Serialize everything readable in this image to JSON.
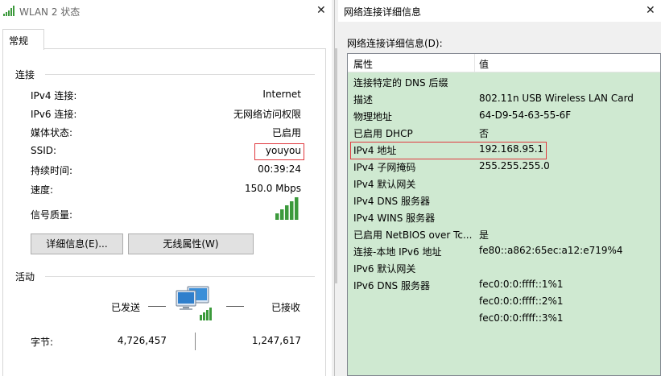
{
  "left_window": {
    "title": "WLAN 2 状态",
    "close_glyph": "✕",
    "tab": "常规",
    "connection": {
      "heading": "连接",
      "rows": [
        {
          "label": "IPv4 连接:",
          "value": "Internet"
        },
        {
          "label": "IPv6 连接:",
          "value": "无网络访问权限"
        },
        {
          "label": "媒体状态:",
          "value": "已启用"
        },
        {
          "label": "SSID:",
          "value": "youyou"
        },
        {
          "label": "持续时间:",
          "value": "00:39:24"
        },
        {
          "label": "速度:",
          "value": "150.0 Mbps"
        }
      ],
      "signal_label": "信号质量:",
      "signal_bars_lit": 5,
      "signal_bars_total": 5
    },
    "buttons": {
      "details": "详细信息(E)...",
      "wireless_props": "无线属性(W)"
    },
    "activity": {
      "heading": "活动",
      "sent_label": "已发送",
      "received_label": "已接收",
      "bytes_label": "字节:",
      "bytes_sent": "4,726,457",
      "bytes_received": "1,247,617"
    }
  },
  "right_window": {
    "title": "网络连接详细信息",
    "close_glyph": "✕",
    "caption": "网络连接详细信息(D):",
    "columns": {
      "property": "属性",
      "value": "值"
    },
    "rows": [
      {
        "property": "连接特定的 DNS 后缀",
        "value": ""
      },
      {
        "property": "描述",
        "value": "802.11n USB Wireless LAN Card"
      },
      {
        "property": "物理地址",
        "value": "64-D9-54-63-55-6F"
      },
      {
        "property": "已启用 DHCP",
        "value": "否"
      },
      {
        "property": "IPv4 地址",
        "value": "192.168.95.1"
      },
      {
        "property": "IPv4 子网掩码",
        "value": "255.255.255.0"
      },
      {
        "property": "IPv4 默认网关",
        "value": ""
      },
      {
        "property": "IPv4 DNS 服务器",
        "value": ""
      },
      {
        "property": "IPv4 WINS 服务器",
        "value": ""
      },
      {
        "property": "已启用 NetBIOS over Tc...",
        "value": "是"
      },
      {
        "property": "连接-本地 IPv6 地址",
        "value": "fe80::a862:65ec:a12:e719%4"
      },
      {
        "property": "IPv6 默认网关",
        "value": ""
      },
      {
        "property": "IPv6 DNS 服务器",
        "value": "fec0:0:0:ffff::1%1"
      },
      {
        "property": "",
        "value": "fec0:0:0:ffff::2%1"
      },
      {
        "property": "",
        "value": "fec0:0:0:ffff::3%1"
      }
    ]
  },
  "colors": {
    "list_background": "#cfe9d1",
    "highlight_box": "#e0393e",
    "signal_green": "#3c9a3c"
  }
}
